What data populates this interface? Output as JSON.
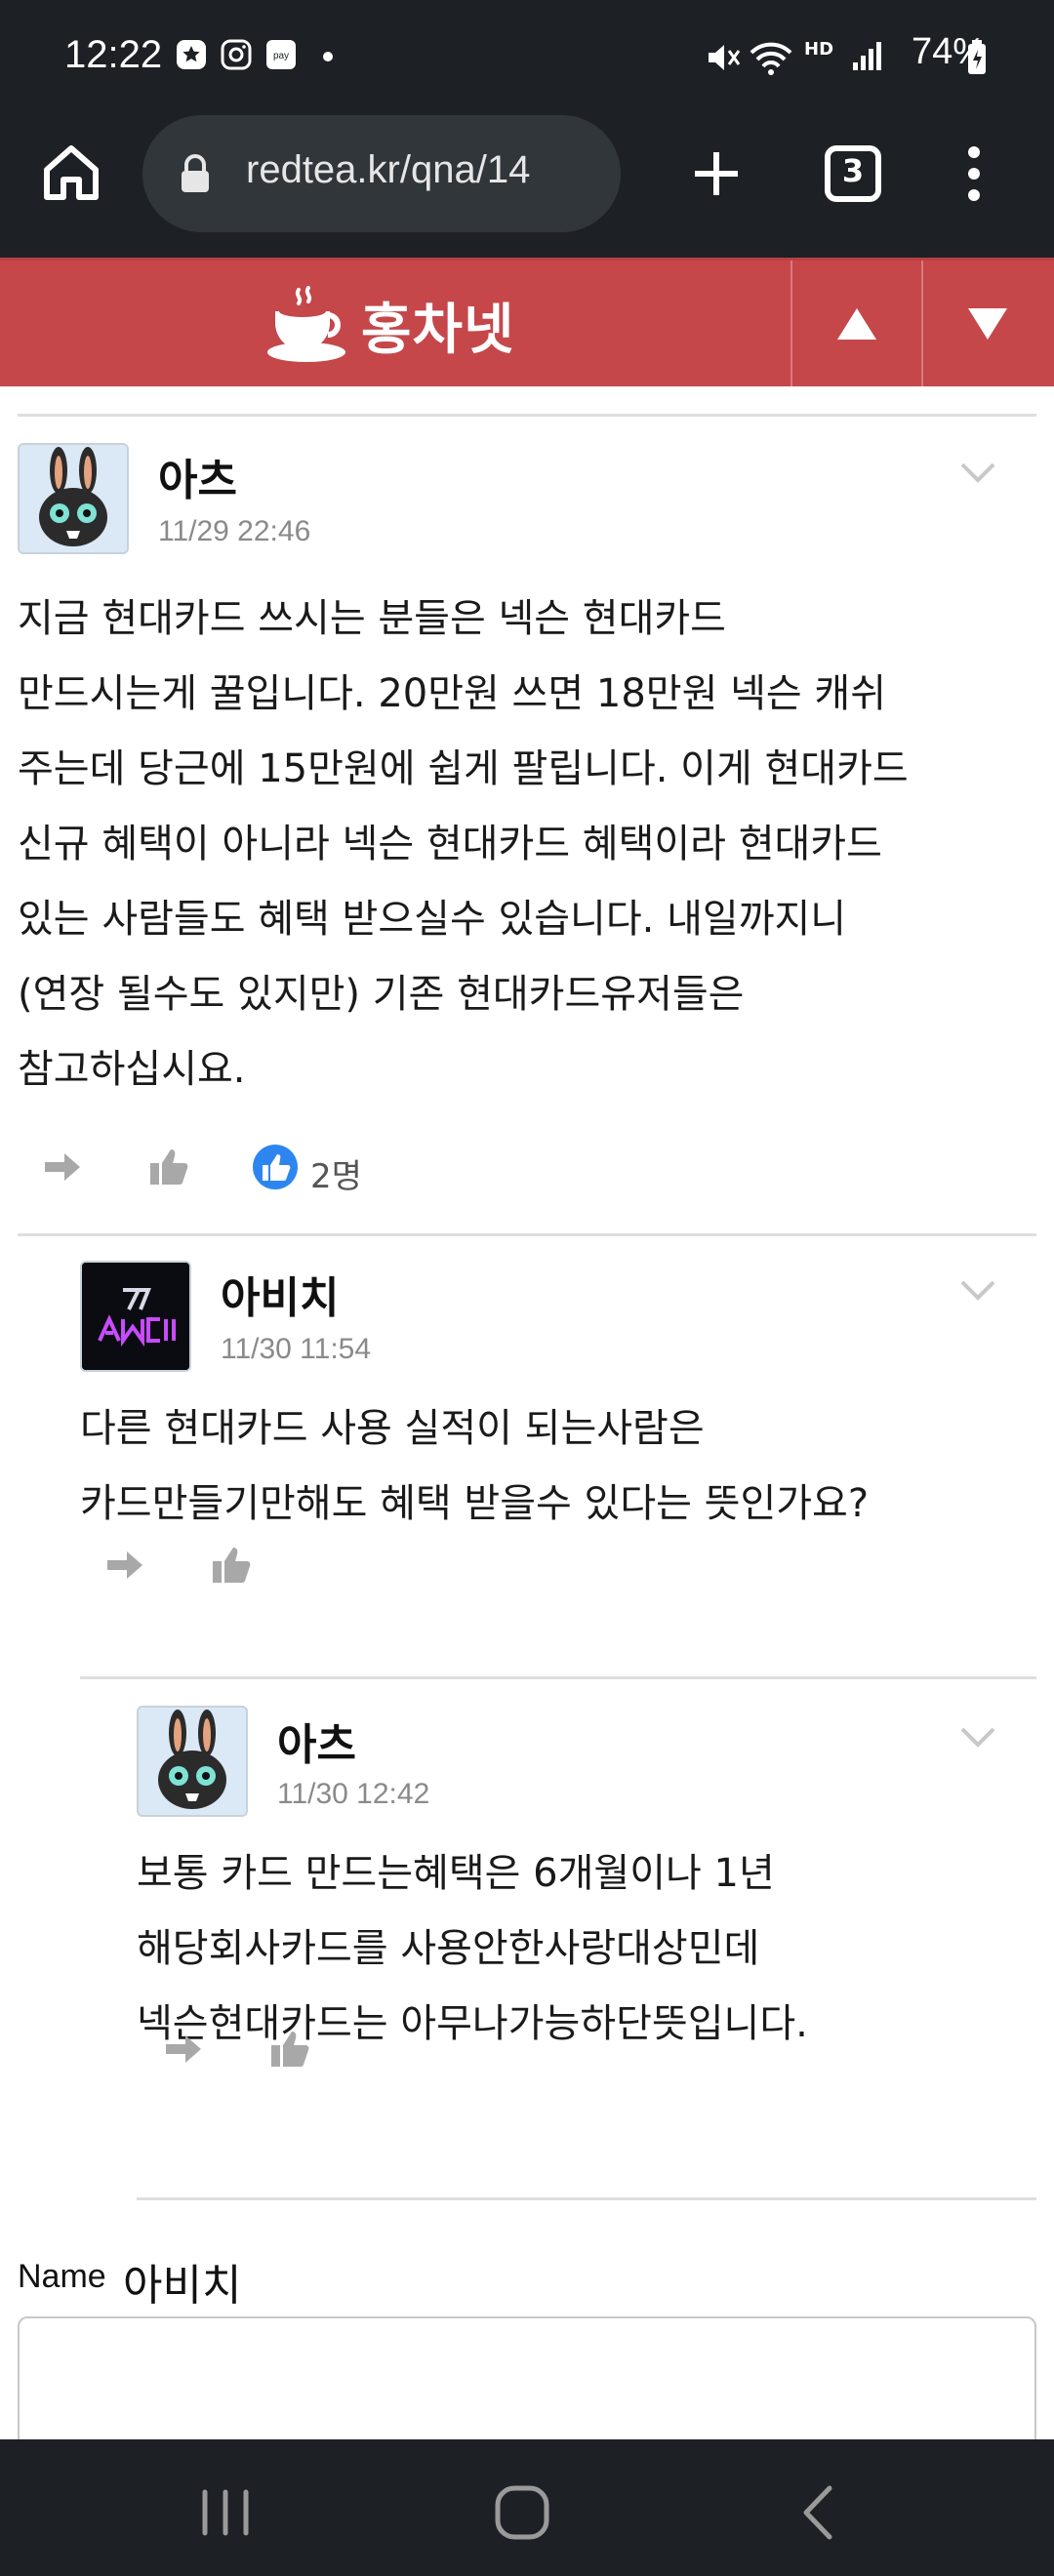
{
  "status_bar": {
    "time": "12:22",
    "battery": "74%",
    "network_label": "HD"
  },
  "browser": {
    "url": "redtea.kr/qna/14",
    "tab_count": "3"
  },
  "site": {
    "logo_text": "홍차넷",
    "brand_color": "#c5474a"
  },
  "comments": [
    {
      "author": "아츠",
      "date": "11/29 22:46",
      "avatar": "rabbit-avatar",
      "body": "지금 현대카드 쓰시는 분들은 넥슨 현대카드\n만드시는게 꿀입니다. 20만원 쓰면 18만원 넥슨 캐쉬\n주는데 당근에 15만원에 쉽게 팔립니다. 이게 현대카드\n신규 혜택이 아니라 넥슨 현대카드 혜택이라 현대카드\n있는 사람들도 혜택 받으실수 있습니다. 내일까지니\n(연장 될수도 있지만) 기존 현대카드유저들은\n참고하십시요.",
      "likes": "2명"
    },
    {
      "author": "아비치",
      "date": "11/30 11:54",
      "avatar": "avicii-avatar",
      "body": "다른 현대카드 사용 실적이 되는사람은\n카드만들기만해도 혜택 받을수 있다는 뜻인가요?"
    },
    {
      "author": "아츠",
      "date": "11/30 12:42",
      "avatar": "rabbit-avatar",
      "body": "보통 카드 만드는혜택은 6개월이나 1년\n해당회사카드를 사용안한사랑대상민데\n넥슨현대카드는 아무나가능하단뜻입니다."
    }
  ],
  "reply_form": {
    "name_label": "Name",
    "name_value": "아비치"
  }
}
